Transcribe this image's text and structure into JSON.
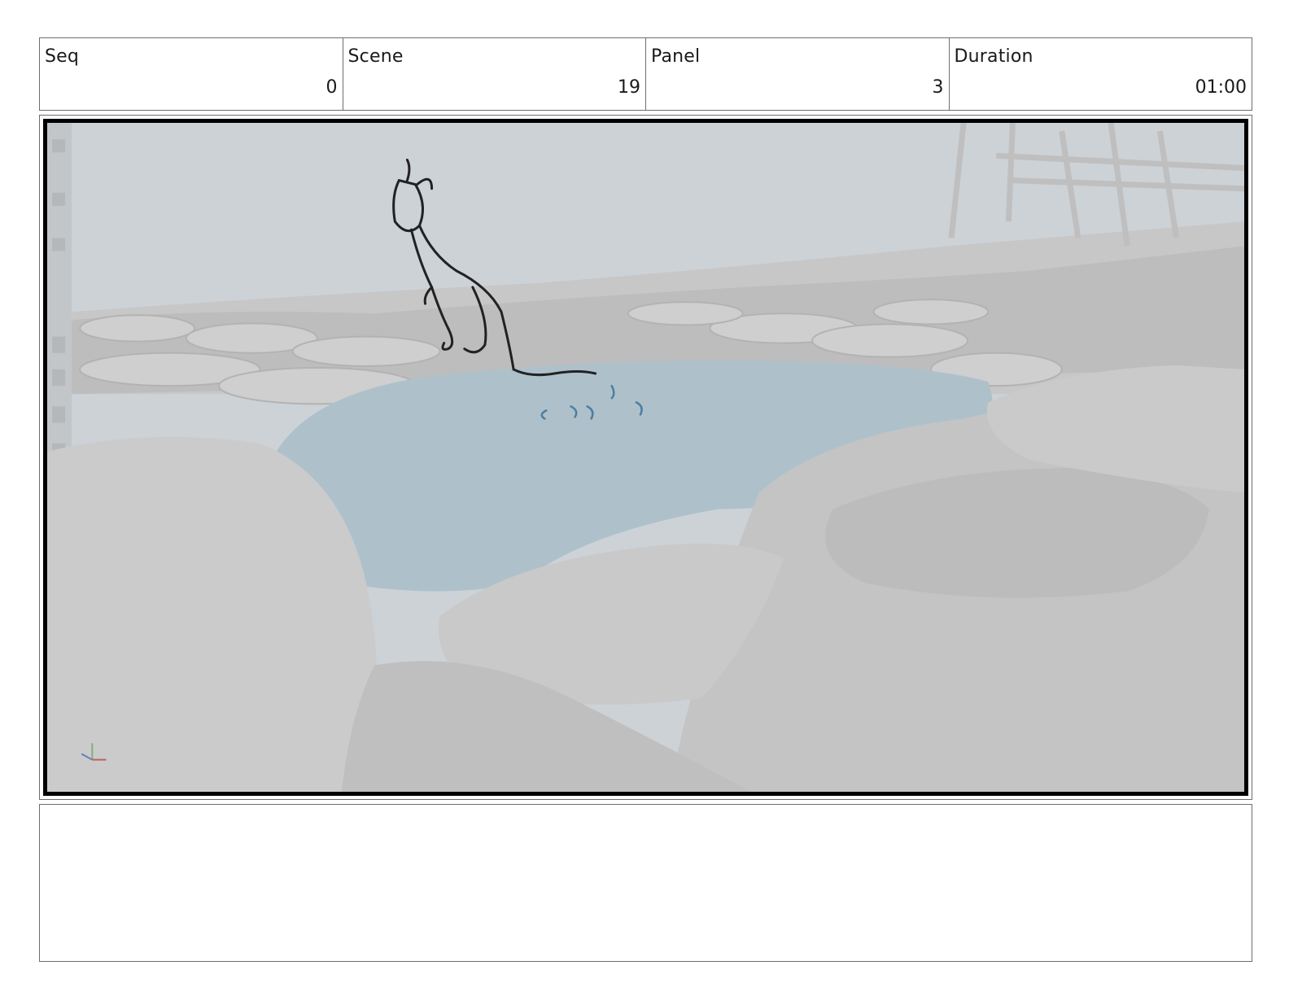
{
  "header": {
    "seq": {
      "label": "Seq",
      "value": "0"
    },
    "scene": {
      "label": "Scene",
      "value": "19"
    },
    "panel": {
      "label": "Panel",
      "value": "3"
    },
    "duration": {
      "label": "Duration",
      "value": "01:00"
    }
  },
  "notes": {
    "text": ""
  }
}
